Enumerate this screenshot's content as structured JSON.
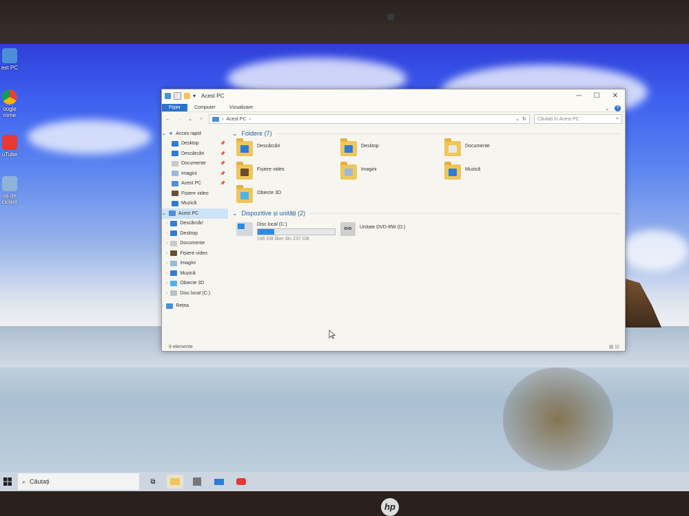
{
  "desktop": {
    "icons": [
      {
        "label": "est PC",
        "color": "#4a90d9"
      },
      {
        "label": "oogle\nrome",
        "color": "#db4437"
      },
      {
        "label": "uTube",
        "color": "#e53935"
      },
      {
        "label": "oș de\nciclare",
        "color": "#8fb3d9"
      }
    ]
  },
  "window": {
    "title": "Acest PC",
    "controls": {
      "minimize": "─",
      "maximize": "☐",
      "close": "✕"
    },
    "ribbon_tabs": [
      "Fișier",
      "Computer",
      "Vizualizare"
    ],
    "address": {
      "path_root": "›",
      "location": "Acest PC",
      "chevron": "›"
    },
    "search_placeholder": "Căutați în Acest PC",
    "nav": {
      "quick_access": "Acces rapid",
      "quick_items": [
        {
          "label": "Desktop",
          "color": "#2e7cd6",
          "pinned": true
        },
        {
          "label": "Descărcări",
          "color": "#2e7cd6",
          "pinned": true
        },
        {
          "label": "Documente",
          "color": "#c8c8c8",
          "pinned": true
        },
        {
          "label": "Imagini",
          "color": "#9ab9d8",
          "pinned": true
        },
        {
          "label": "Acest PC",
          "color": "#4a90d9",
          "pinned": true
        },
        {
          "label": "Fișiere video",
          "color": "#6b4e2e",
          "pinned": false
        },
        {
          "label": "Muzică",
          "color": "#2e7cd6",
          "pinned": false
        }
      ],
      "this_pc": "Acest PC",
      "pc_items": [
        {
          "label": "Descărcări",
          "color": "#2e7cd6"
        },
        {
          "label": "Desktop",
          "color": "#2e7cd6"
        },
        {
          "label": "Documente",
          "color": "#c8c8c8"
        },
        {
          "label": "Fișiere video",
          "color": "#6b4e2e"
        },
        {
          "label": "Imagini",
          "color": "#9ab9d8"
        },
        {
          "label": "Muzică",
          "color": "#2e7cd6"
        },
        {
          "label": "Obiecte 3D",
          "color": "#4fb3e8"
        },
        {
          "label": "Disc local (C:)",
          "color": "#b8c2cc"
        }
      ],
      "network": "Rețea"
    },
    "folders_header": "Foldere (7)",
    "folders": [
      {
        "label": "Descărcări",
        "overlay": "#2e7cd6"
      },
      {
        "label": "Desktop",
        "overlay": "#2e7cd6"
      },
      {
        "label": "Documente",
        "overlay": "#e8e8e8"
      },
      {
        "label": "Fișiere video",
        "overlay": "#6b4e2e"
      },
      {
        "label": "Imagini",
        "overlay": "#9ab9d8"
      },
      {
        "label": "Muzică",
        "overlay": "#2e7cd6"
      },
      {
        "label": "Obiecte 3D",
        "overlay": "#4fb3e8"
      }
    ],
    "devices_header": "Dispozitive și unități (2)",
    "drives": [
      {
        "label": "Disc local (C:)",
        "free": "186 GB liber din 237 GB",
        "used_fraction": 0.215
      },
      {
        "label": "Unitate DVD-RW (D:)",
        "badge": "DVD"
      }
    ],
    "status": "9 elemente"
  },
  "taskbar": {
    "start_icon": "windows-logo",
    "search_text": "Căutați",
    "apps": [
      "task-view",
      "file-explorer",
      "store",
      "mail",
      "youtube"
    ]
  },
  "brand": "hp"
}
